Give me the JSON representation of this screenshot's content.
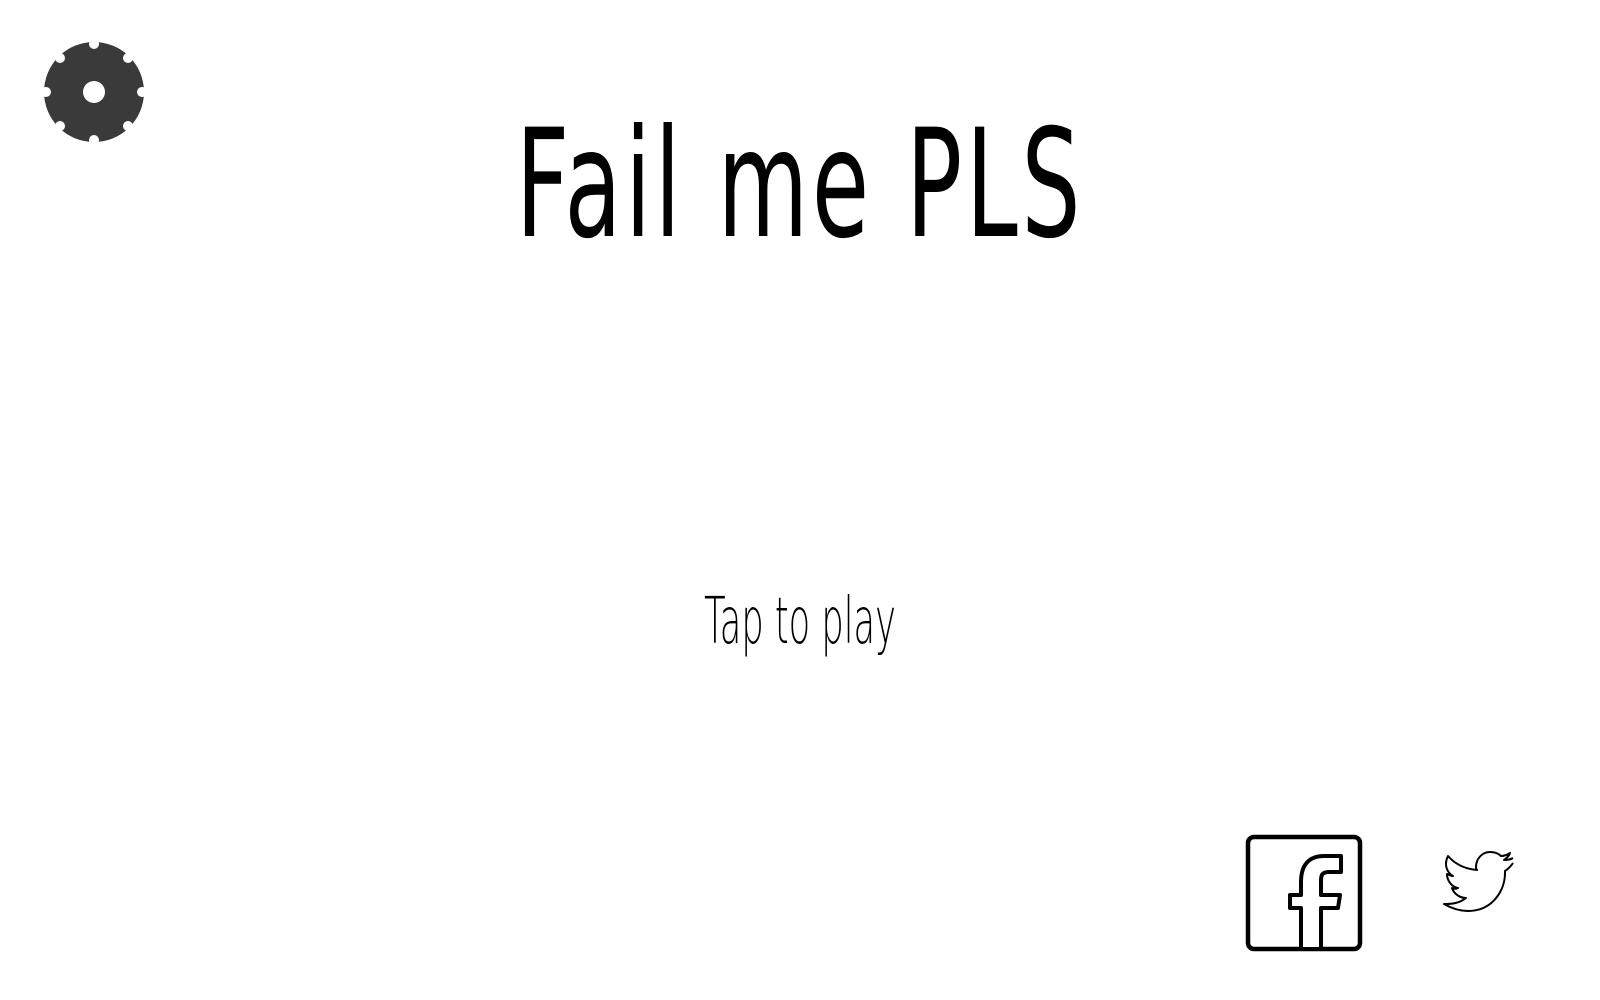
{
  "game": {
    "title": "Fail me PLS",
    "prompt": "Tap to play"
  },
  "icons": {
    "settings": "gear-icon",
    "facebook": "facebook-icon",
    "twitter": "twitter-bird-icon"
  },
  "colors": {
    "background": "#ffffff",
    "text": "#000000",
    "gear": "#3a3a3a"
  }
}
